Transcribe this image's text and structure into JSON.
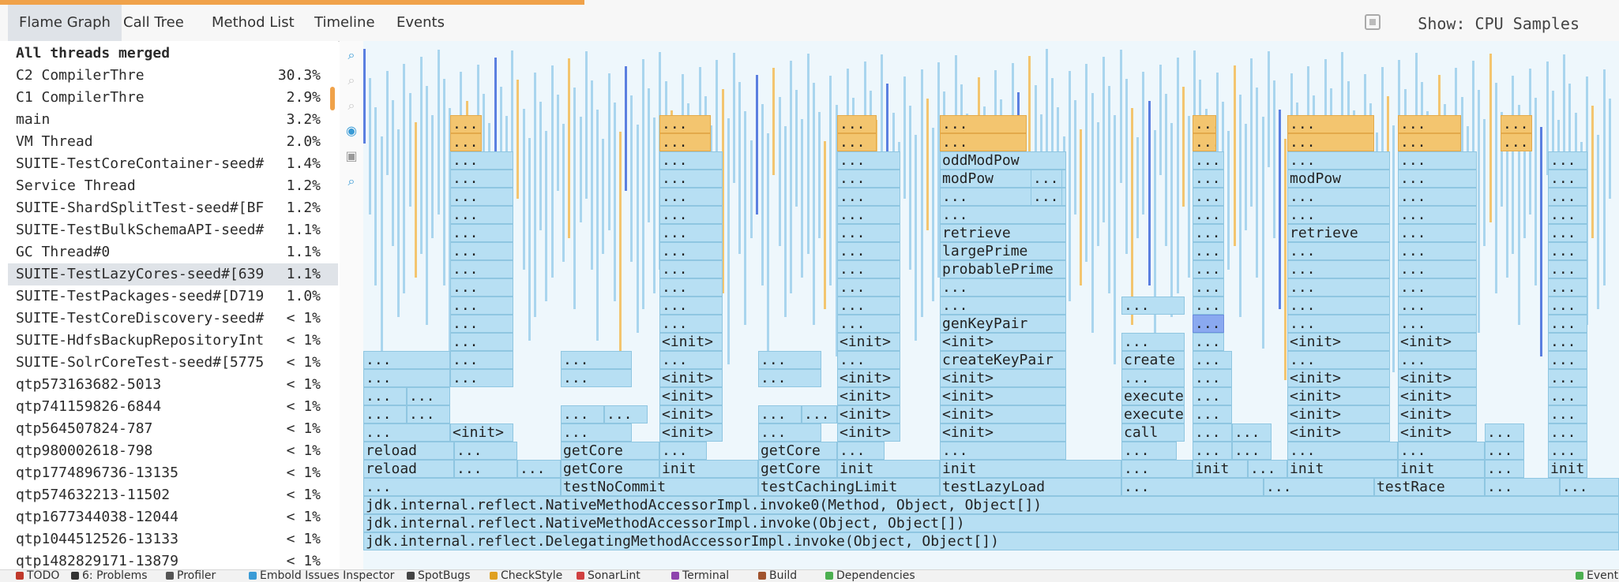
{
  "tabs": [
    {
      "label": "Flame Graph",
      "active": true
    },
    {
      "label": "Call Tree"
    },
    {
      "label": "Method List"
    },
    {
      "label": "Timeline"
    },
    {
      "label": "Events"
    }
  ],
  "show_label": "Show: CPU Samples",
  "threads": [
    {
      "name": "All threads merged",
      "pct": ""
    },
    {
      "name": "C2 CompilerThre",
      "pct": "30.3%"
    },
    {
      "name": "C1 CompilerThre",
      "pct": "2.9%"
    },
    {
      "name": "main",
      "pct": "3.2%"
    },
    {
      "name": "VM Thread",
      "pct": "2.0%"
    },
    {
      "name": "SUITE-TestCoreContainer-seed#",
      "pct": "1.4%"
    },
    {
      "name": "Service Thread",
      "pct": "1.2%"
    },
    {
      "name": "SUITE-ShardSplitTest-seed#[BF",
      "pct": "1.2%"
    },
    {
      "name": "SUITE-TestBulkSchemaAPI-seed#",
      "pct": "1.1%"
    },
    {
      "name": "GC Thread#0",
      "pct": "1.1%"
    },
    {
      "name": "SUITE-TestLazyCores-seed#[639",
      "pct": "1.1%"
    },
    {
      "name": "SUITE-TestPackages-seed#[D719",
      "pct": "1.0%"
    },
    {
      "name": "SUITE-TestCoreDiscovery-seed#",
      "pct": "< 1%"
    },
    {
      "name": "SUITE-HdfsBackupRepositoryInt",
      "pct": "< 1%"
    },
    {
      "name": "SUITE-SolrCoreTest-seed#[5775",
      "pct": "< 1%"
    },
    {
      "name": "qtp573163682-5013",
      "pct": "< 1%"
    },
    {
      "name": "qtp741159826-6844",
      "pct": "< 1%"
    },
    {
      "name": "qtp564507824-787",
      "pct": "< 1%"
    },
    {
      "name": "qtp980002618-798",
      "pct": "< 1%"
    },
    {
      "name": "qtp1774896736-13135",
      "pct": "< 1%"
    },
    {
      "name": "qtp574632213-11502",
      "pct": "< 1%"
    },
    {
      "name": "qtp1677344038-12044",
      "pct": "< 1%"
    },
    {
      "name": "qtp1044512526-13133",
      "pct": "< 1%"
    },
    {
      "name": "qtp1482829171-13879",
      "pct": "< 1%"
    }
  ],
  "selected_thread": "SUITE-TestLazyCores-seed#[639",
  "zoom_icons": [
    "zoom-in-icon",
    "zoom-out-icon",
    "zoom-reset-icon",
    "eye-icon",
    "camera-icon",
    "search-icon"
  ],
  "flame_labels": {
    "dots": "...",
    "init": "<init>",
    "reload": "reload",
    "getCore": "getCore",
    "initm": "init",
    "testNoCommit": "testNoCommit",
    "testCachingLimit": "testCachingLimit",
    "testLazyLoad": "testLazyLoad",
    "testRace": "testRace",
    "oddModPow": "oddModPow",
    "modPow": "modPow",
    "retrieve": "retrieve",
    "largePrime": "largePrime",
    "probablePrime": "probablePrime",
    "genKeyPair": "genKeyPair",
    "createKeyPair": "createKeyPair",
    "create": "create",
    "execute": "execute",
    "call": "call",
    "invoke0": "jdk.internal.reflect.NativeMethodAccessorImpl.invoke0(Method, Object, Object[])",
    "invoke": "jdk.internal.reflect.NativeMethodAccessorImpl.invoke(Object, Object[])",
    "delegating": "jdk.internal.reflect.DelegatingMethodAccessorImpl.invoke(Object, Object[])"
  },
  "bottom_tools": [
    {
      "label": "TODO",
      "icon": "todo-icon"
    },
    {
      "label": "6: Problems",
      "icon": "problems-icon"
    },
    {
      "label": "Profiler",
      "icon": "profiler-icon"
    },
    {
      "label": "Embold Issues Inspector",
      "icon": "embold-icon"
    },
    {
      "label": "SpotBugs",
      "icon": "spotbugs-icon"
    },
    {
      "label": "CheckStyle",
      "icon": "checkstyle-icon"
    },
    {
      "label": "SonarLint",
      "icon": "sonarlint-icon"
    },
    {
      "label": "Terminal",
      "icon": "terminal-icon"
    },
    {
      "label": "Build",
      "icon": "build-icon"
    },
    {
      "label": "Dependencies",
      "icon": "dependencies-icon"
    },
    {
      "label": "Event",
      "icon": "event-icon"
    }
  ],
  "colors": {
    "frame": "#b7dff3",
    "hot": "#f3c56f",
    "accent": "#f0a24a",
    "highlight": "#8aa9f0"
  }
}
